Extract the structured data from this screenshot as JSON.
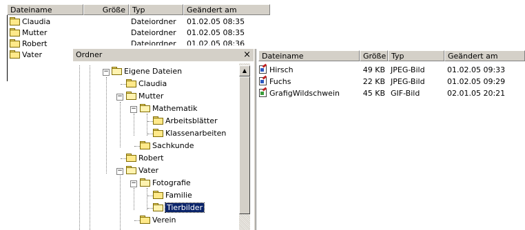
{
  "background_list": {
    "columns": [
      "Dateiname",
      "Größe",
      "Typ",
      "Geändert am"
    ],
    "rows": [
      {
        "name": "Claudia",
        "size": "",
        "type": "Dateiordner",
        "modified": "01.02.05 08:35"
      },
      {
        "name": "Mutter",
        "size": "",
        "type": "Dateiordner",
        "modified": "01.02.05 08:35"
      },
      {
        "name": "Robert",
        "size": "",
        "type": "Dateiordner",
        "modified": "01.02.05 08:36"
      },
      {
        "name": "Vater",
        "size": "",
        "type": "",
        "modified": ""
      }
    ]
  },
  "folder_pane": {
    "title": "Ordner",
    "close_glyph": "×",
    "tree": [
      {
        "label": "Eigene Dateien",
        "state": "expanded"
      },
      {
        "label": "Claudia",
        "state": "leaf"
      },
      {
        "label": "Mutter",
        "state": "expanded"
      },
      {
        "label": "Mathematik",
        "state": "expanded"
      },
      {
        "label": "Arbeitsblätter",
        "state": "leaf"
      },
      {
        "label": "Klassenarbeiten",
        "state": "leaf"
      },
      {
        "label": "Sachkunde",
        "state": "leaf"
      },
      {
        "label": "Robert",
        "state": "leaf"
      },
      {
        "label": "Vater",
        "state": "expanded"
      },
      {
        "label": "Fotografie",
        "state": "expanded"
      },
      {
        "label": "Familie",
        "state": "leaf"
      },
      {
        "label": "Tierbilder",
        "state": "selected"
      },
      {
        "label": "Verein",
        "state": "leaf"
      }
    ]
  },
  "file_list": {
    "columns": [
      "Dateiname",
      "Größe",
      "Typ",
      "Geändert am"
    ],
    "rows": [
      {
        "name": "Hirsch",
        "size": "49 KB",
        "type": "JPEG-Bild",
        "modified": "01.02.05 09:33",
        "icon": "jpeg-file-icon"
      },
      {
        "name": "Fuchs",
        "size": "22 KB",
        "type": "JPEG-Bild",
        "modified": "01.02.05 09:29",
        "icon": "jpeg-file-icon"
      },
      {
        "name": "GrafigWildschwein",
        "size": "45 KB",
        "type": "GIF-Bild",
        "modified": "02.01.05 20:21",
        "icon": "gif-file-icon"
      }
    ]
  },
  "colors": {
    "selection": "#0a246a",
    "chrome": "#d4d0c8"
  }
}
